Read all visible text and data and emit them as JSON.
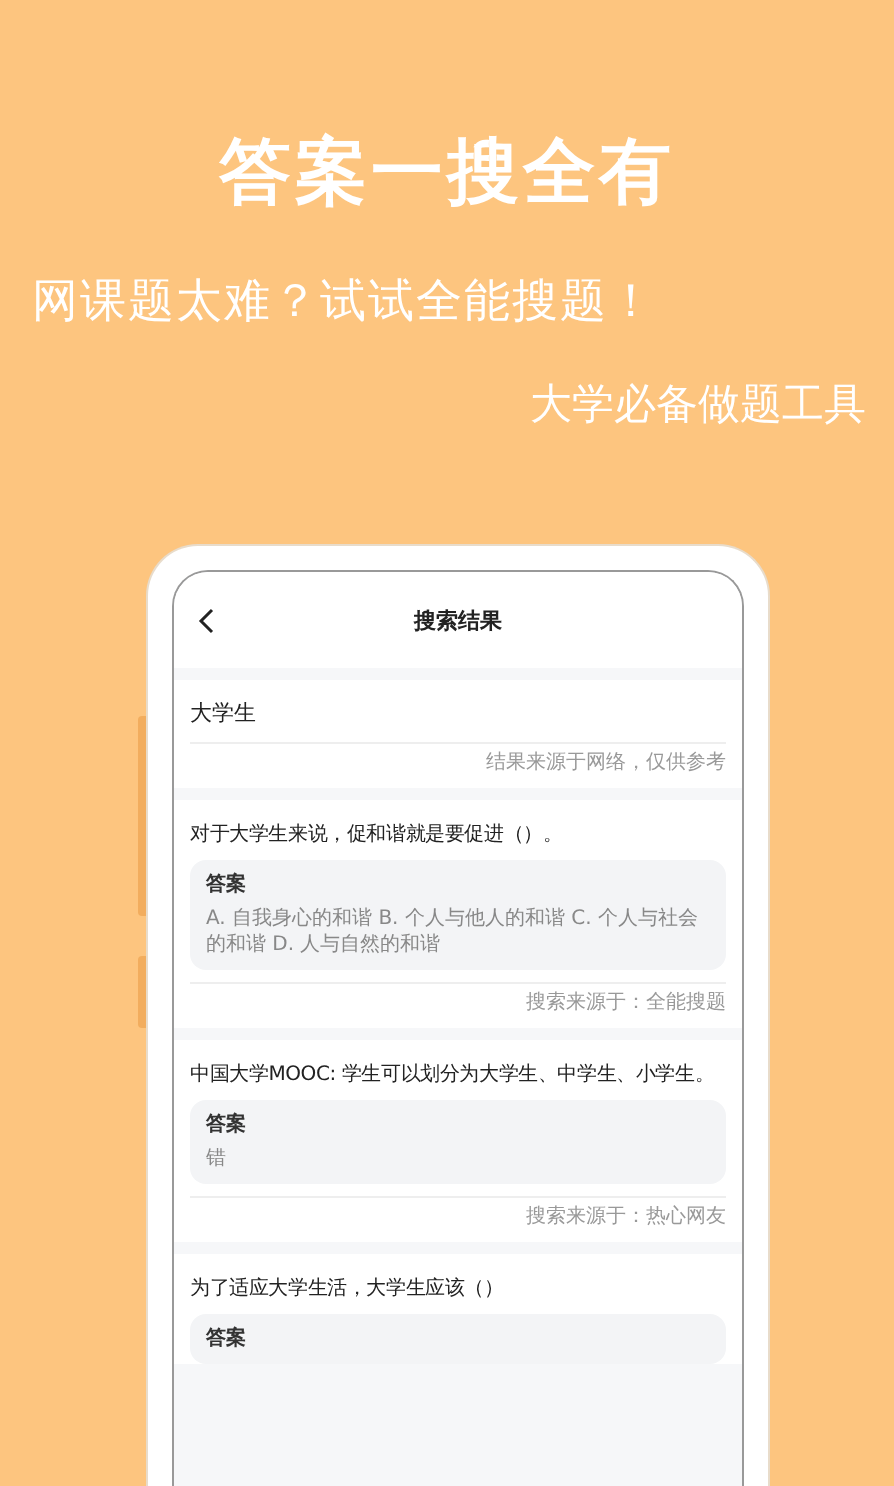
{
  "headline": "答案一搜全有",
  "subtitle": "网课题太难？试试全能搜题！",
  "tagline": "大学必备做题工具",
  "screen": {
    "title": "搜索结果",
    "query": "大学生",
    "disclaimer": "结果来源于网络，仅供参考",
    "results": [
      {
        "question": "对于大学生来说，促和谐就是要促进（）。",
        "answer_label": "答案",
        "answer": "A. 自我身心的和谐 B. 个人与他人的和谐 C. 个人与社会的和谐 D. 人与自然的和谐",
        "source": "搜索来源于：全能搜题"
      },
      {
        "question": "中国大学MOOC: 学生可以划分为大学生、中学生、小学生。",
        "answer_label": "答案",
        "answer": "错",
        "source": "搜索来源于：热心网友"
      },
      {
        "question": "为了适应大学生活，大学生应该（）",
        "answer_label": "答案"
      }
    ]
  }
}
